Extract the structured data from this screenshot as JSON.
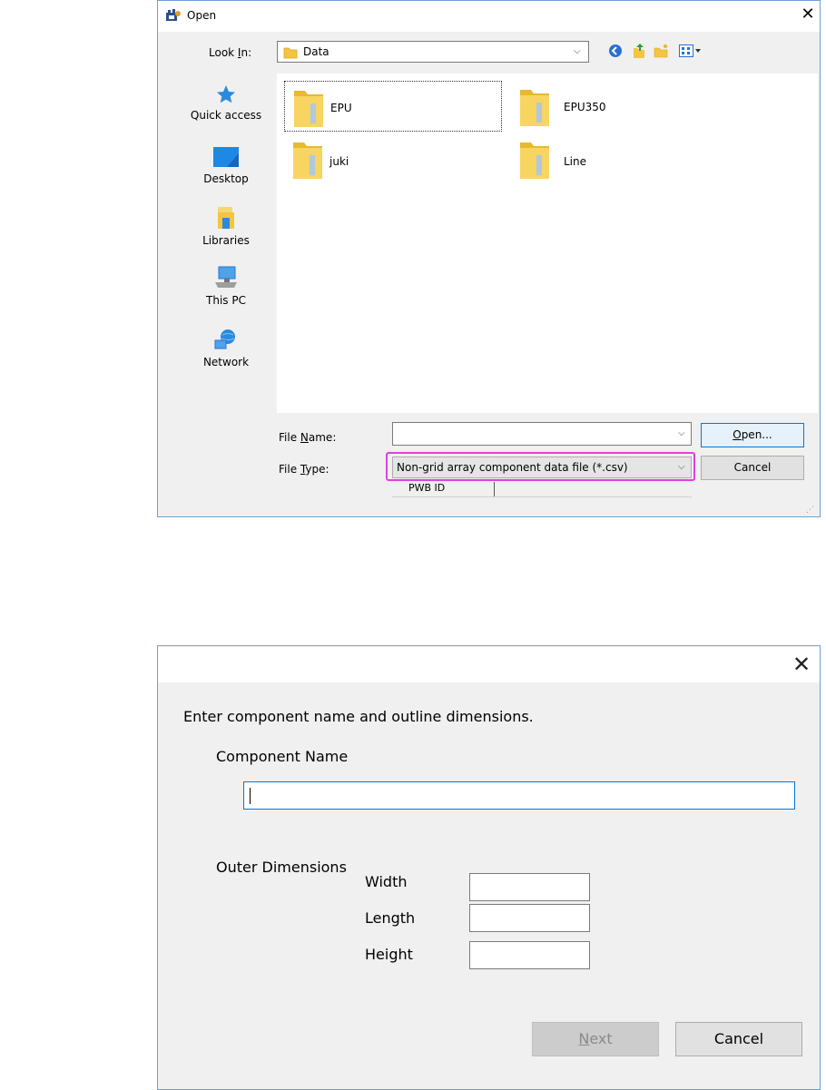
{
  "open_dialog": {
    "title": "Open",
    "look_in": {
      "label_pre": "Look ",
      "label_key": "I",
      "label_post": "n:",
      "value": "Data"
    },
    "places": [
      {
        "label": "Quick access",
        "icon": "star-icon"
      },
      {
        "label": "Desktop",
        "icon": "desktop-icon"
      },
      {
        "label": "Libraries",
        "icon": "library-icon"
      },
      {
        "label": "This PC",
        "icon": "computer-icon"
      },
      {
        "label": "Network",
        "icon": "network-icon"
      }
    ],
    "files": [
      {
        "name": "EPU",
        "selected": true
      },
      {
        "name": "EPU350",
        "selected": false
      },
      {
        "name": "juki",
        "selected": false
      },
      {
        "name": "Line",
        "selected": false
      }
    ],
    "file_name": {
      "label_pre": "File ",
      "label_key": "N",
      "label_post": "ame:",
      "value": ""
    },
    "file_type": {
      "label_pre": "File ",
      "label_key": "T",
      "label_post": "ype:",
      "value": "Non-grid array component data file (*.csv)"
    },
    "open_button": {
      "key": "O",
      "rest": "pen..."
    },
    "cancel_button": "Cancel",
    "pwb_label": "PWB ID",
    "highlight_color": "#e040e0"
  },
  "component_dialog": {
    "instruction": "Enter component name and outline dimensions.",
    "component_name_label": "Component Name",
    "component_name_value": "",
    "outer_dimensions_label": "Outer Dimensions",
    "dimensions": [
      {
        "label": "Width",
        "value": ""
      },
      {
        "label": "Length",
        "value": ""
      },
      {
        "label": "Height",
        "value": ""
      }
    ],
    "next_button": {
      "key": "N",
      "rest": "ext"
    },
    "cancel_button": "Cancel"
  }
}
